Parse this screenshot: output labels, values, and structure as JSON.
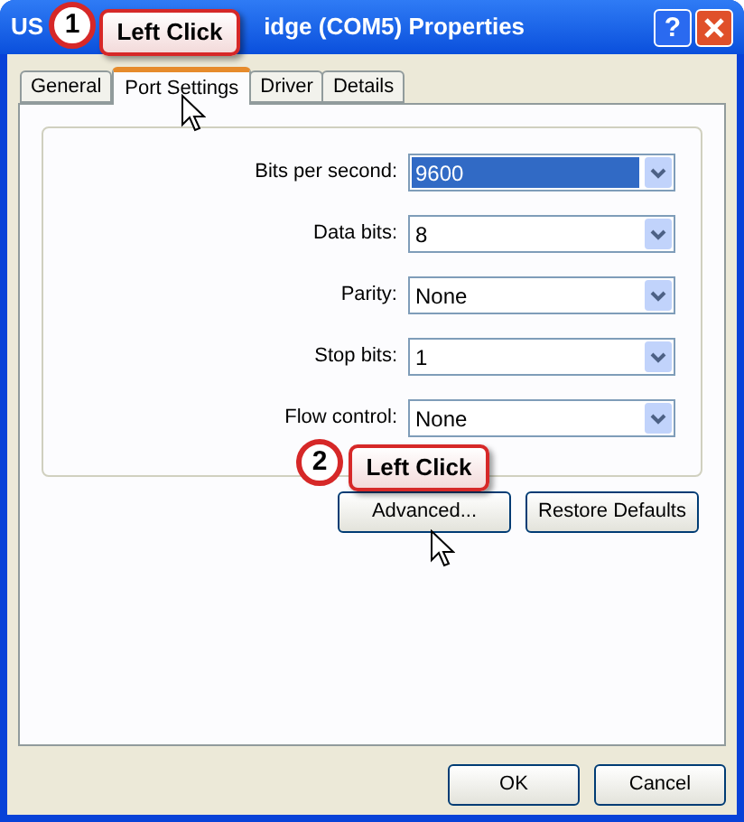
{
  "window": {
    "title_parts": [
      "US",
      "idge (COM5) Properties"
    ],
    "help_button": "?"
  },
  "tabs": [
    {
      "label": "General",
      "selected": false
    },
    {
      "label": "Port Settings",
      "selected": true
    },
    {
      "label": "Driver",
      "selected": false
    },
    {
      "label": "Details",
      "selected": false
    }
  ],
  "settings": [
    {
      "label": "Bits per second:",
      "value": "9600",
      "highlighted": true
    },
    {
      "label": "Data bits:",
      "value": "8",
      "highlighted": false
    },
    {
      "label": "Parity:",
      "value": "None",
      "highlighted": false
    },
    {
      "label": "Stop bits:",
      "value": "1",
      "highlighted": false
    },
    {
      "label": "Flow control:",
      "value": "None",
      "highlighted": false
    }
  ],
  "buttons": [
    "Advanced...",
    "Restore Defaults"
  ],
  "dialog_buttons": [
    "OK",
    "Cancel"
  ],
  "callouts": [
    {
      "number": "1",
      "text": "Left Click"
    },
    {
      "number": "2",
      "text": "Left Click"
    }
  ]
}
